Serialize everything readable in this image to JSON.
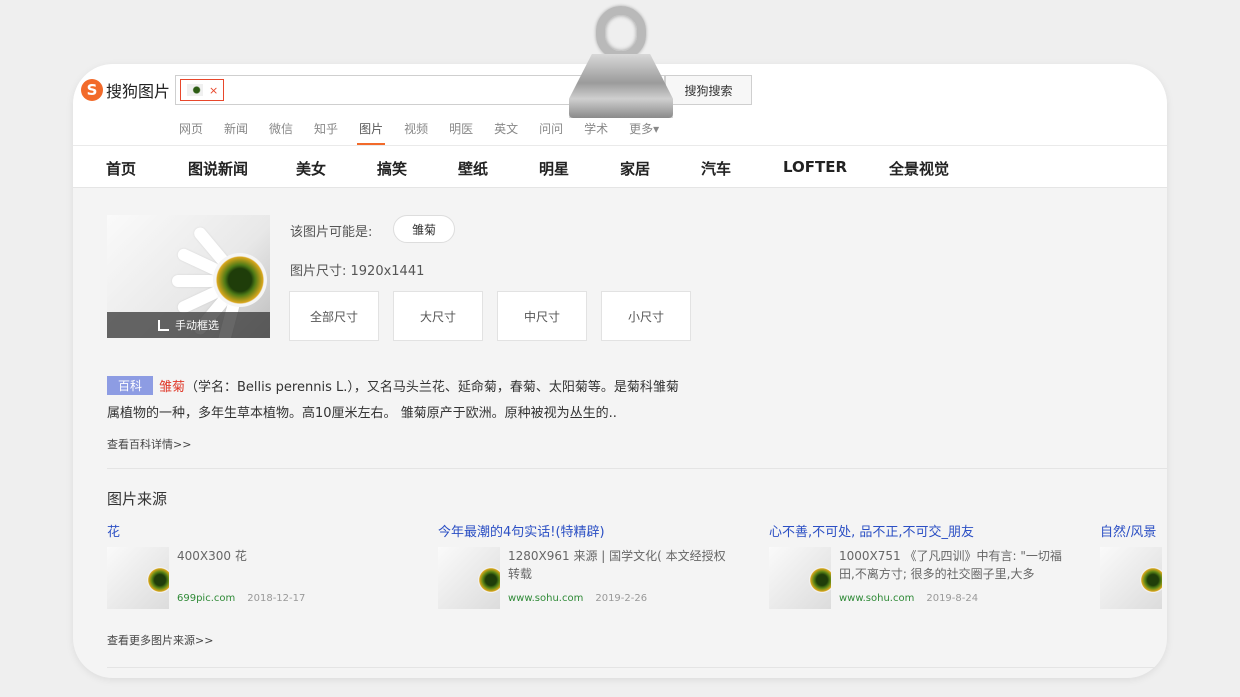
{
  "header": {
    "logo_mark": "S",
    "logo_text": "搜狗图片",
    "chip_close": "×",
    "search_button": "搜狗搜索"
  },
  "nav_small": [
    "网页",
    "新闻",
    "微信",
    "知乎",
    "图片",
    "视频",
    "明医",
    "英文",
    "问问",
    "学术",
    "更多▾"
  ],
  "nav_main": [
    "首页",
    "图说新闻",
    "美女",
    "搞笑",
    "壁纸",
    "明星",
    "家居",
    "汽车",
    "LOFTER",
    "全景视觉"
  ],
  "result": {
    "crop_label": "手动框选",
    "guess_label": "该图片可能是:",
    "guess_tag": "雏菊",
    "size_label": "图片尺寸: 1920x1441",
    "size_buttons": [
      "全部尺寸",
      "大尺寸",
      "中尺寸",
      "小尺寸"
    ]
  },
  "baike": {
    "tag": "百科",
    "word": "雏菊",
    "line1_rest": "（学名：Bellis perennis L.），又名马头兰花、延命菊，春菊、太阳菊等。是菊科雏菊",
    "line2": "属植物的一种，多年生草本植物。高10厘米左右。 雏菊原产于欧洲。原种被视为丛生的..",
    "more": "查看百科详情>>"
  },
  "sources": {
    "title": "图片来源",
    "items": [
      {
        "title": "花",
        "desc": "400X300 花",
        "site": "699pic.com",
        "date": "2018-12-17"
      },
      {
        "title": "今年最潮的4句实话!(特精辟)",
        "desc": "1280X961 来源 | 国学文化( 本文经授权转载",
        "site": "www.sohu.com",
        "date": "2019-2-26"
      },
      {
        "title": "心不善,不可处, 品不正,不可交_朋友",
        "desc": "1000X751 《了凡四训》中有言: \"一切福田,不离方寸; 很多的社交圈子里,大多",
        "site": "www.sohu.com",
        "date": "2019-8-24"
      },
      {
        "title": "自然/风景",
        "desc": "",
        "site": "",
        "date": ""
      }
    ],
    "more": "查看更多图片来源>>"
  },
  "colors": {
    "brand": "#f26a2a",
    "link": "#2b4fc4",
    "site": "#2f8a37",
    "highlight": "#e03a2b",
    "baike_tag": "#8d9ce3"
  }
}
